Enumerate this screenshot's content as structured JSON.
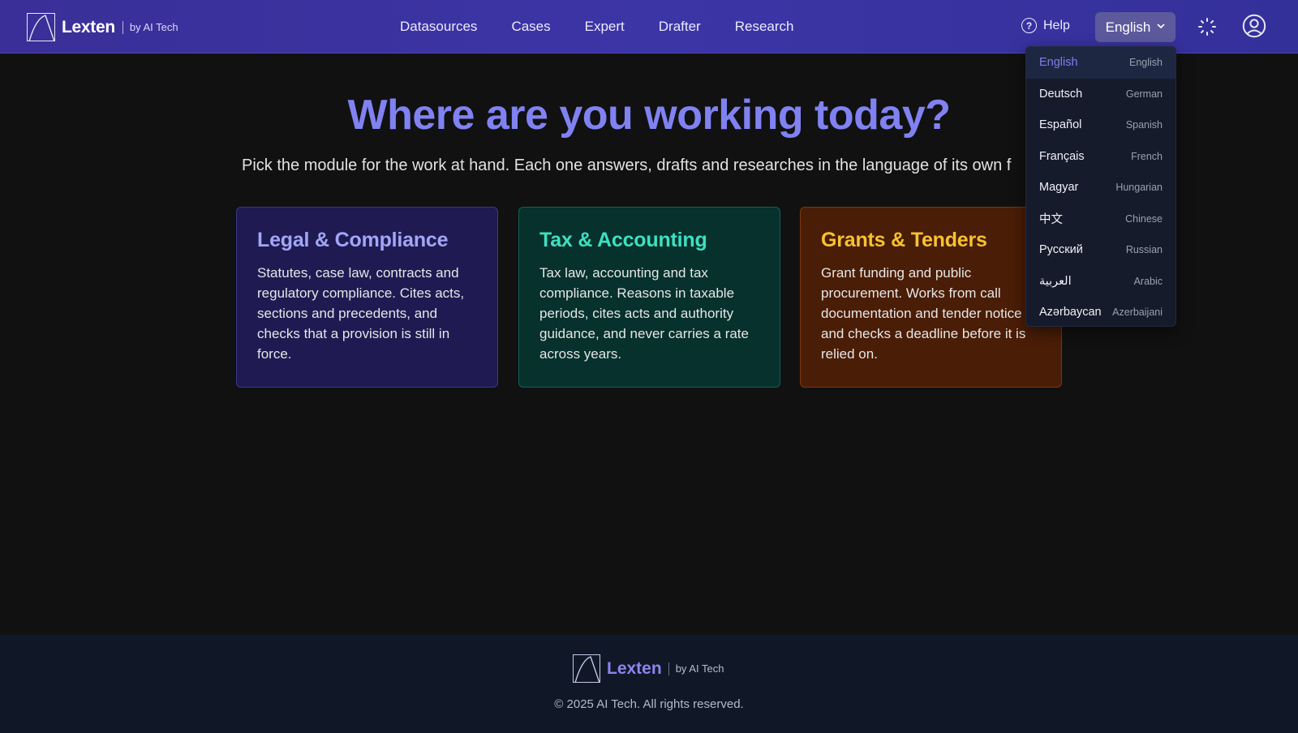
{
  "header": {
    "brand_name": "Lexten",
    "brand_by": "by AI Tech",
    "nav": [
      "Datasources",
      "Cases",
      "Expert",
      "Drafter",
      "Research"
    ],
    "help_label": "Help",
    "language_button": "English"
  },
  "language_menu": [
    {
      "native": "English",
      "english": "English",
      "selected": true
    },
    {
      "native": "Deutsch",
      "english": "German"
    },
    {
      "native": "Español",
      "english": "Spanish"
    },
    {
      "native": "Français",
      "english": "French"
    },
    {
      "native": "Magyar",
      "english": "Hungarian"
    },
    {
      "native": "中文",
      "english": "Chinese"
    },
    {
      "native": "Русский",
      "english": "Russian"
    },
    {
      "native": "العربية",
      "english": "Arabic"
    },
    {
      "native": "Azərbaycan",
      "english": "Azerbaijani"
    }
  ],
  "main": {
    "title": "Where are you working today?",
    "subtitle": "Pick the module for the work at hand. Each one answers, drafts and researches in the language of its own f",
    "cards": [
      {
        "title": "Legal & Compliance",
        "body": "Statutes, case law, contracts and regulatory compliance. Cites acts, sections and precedents, and checks that a provision is still in force."
      },
      {
        "title": "Tax & Accounting",
        "body": "Tax law, accounting and tax compliance. Reasons in taxable periods, cites acts and authority guidance, and never carries a rate across years."
      },
      {
        "title": "Grants & Tenders",
        "body": "Grant funding and public procurement. Works from call documentation and tender notice and checks a deadline before it is relied on."
      }
    ]
  },
  "footer": {
    "brand_name": "Lexten",
    "brand_by": "by AI Tech",
    "copyright": "© 2025 AI Tech. All rights reserved."
  },
  "colors": {
    "header_bg": "#3a2f98",
    "accent": "#8082f2",
    "legal": "#a3a6f7",
    "tax": "#3ee0c0",
    "grants": "#f6c232"
  }
}
